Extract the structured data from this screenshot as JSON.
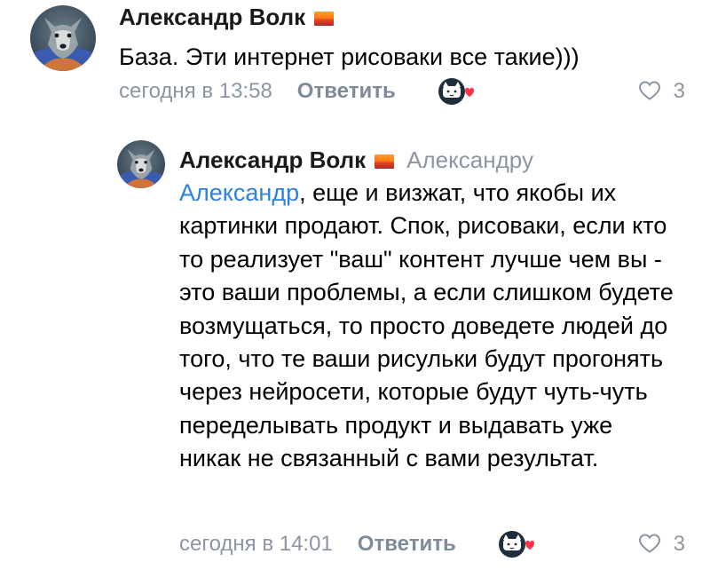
{
  "comments": [
    {
      "author": "Александр Волк",
      "text": "База. Эти интернет рисоваки все такие)))",
      "time": "сегодня в 13:58",
      "reply_label": "Ответить",
      "likes": "3"
    },
    {
      "author": "Александр Волк",
      "reply_to": "Александру",
      "mention": "Александр",
      "text": ", еще и визжат, что якобы их картинки продают. Спок, рисоваки, если кто то реализует \"ваш\" контент лучше чем вы - это ваши проблемы, а если слишком будете возмущаться, то просто доведете людей до того, что те ваши рисульки будут прогонять через нейросети, которые будут чуть-чуть переделывать продукт и выдавать уже никак не связанный с вами результат.",
      "time": "сегодня в 14:01",
      "reply_label": "Ответить",
      "likes": "3"
    }
  ],
  "colors": {
    "secondary_text": "#8c96a3",
    "link": "#2d81e0",
    "heart": "#ff3347",
    "reaction_badge": "#1f2e3d"
  },
  "icons": {
    "status_badge": "sunset-flag-icon",
    "reaction": "cat-with-heart-icon",
    "like": "heart-outline-icon"
  }
}
